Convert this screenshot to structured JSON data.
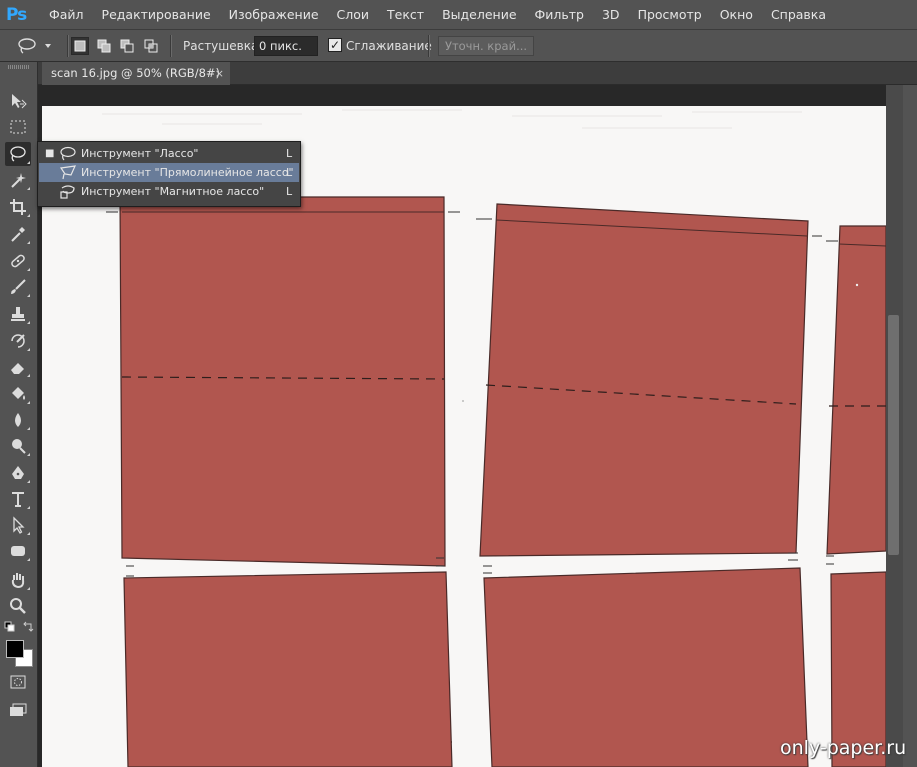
{
  "app": {
    "logo": "Ps",
    "brand_color": "#31a8ff"
  },
  "menu": [
    "Файл",
    "Редактирование",
    "Изображение",
    "Слои",
    "Текст",
    "Выделение",
    "Фильтр",
    "3D",
    "Просмотр",
    "Окно",
    "Справка"
  ],
  "options": {
    "tool_icon": "lasso-icon",
    "feather_label": "Растушевка:",
    "feather_value": "0 пикс.",
    "antialias_checked": true,
    "antialias_label": "Сглаживание",
    "refine_edge_label": "Уточн. край..."
  },
  "document": {
    "tab_title": "scan 16.jpg @ 50% (RGB/8#)",
    "close_glyph": "×"
  },
  "tools": [
    "move-icon",
    "marquee-icon",
    "lasso-icon",
    "magic-wand-icon",
    "crop-icon",
    "eyedropper-icon",
    "healing-brush-icon",
    "brush-icon",
    "clone-stamp-icon",
    "history-brush-icon",
    "eraser-icon",
    "paint-bucket-icon",
    "blur-icon",
    "dodge-icon",
    "pen-icon",
    "type-icon",
    "path-selection-icon",
    "shape-icon",
    "hand-icon",
    "zoom-icon",
    "quick-mask-icon",
    "screen-mode-icon"
  ],
  "flyout": {
    "items": [
      {
        "label": "Инструмент \"Лассо\"",
        "shortcut": "L",
        "selected": true,
        "highlighted": false
      },
      {
        "label": "Инструмент \"Прямолинейное лассо\"",
        "shortcut": "L",
        "selected": false,
        "highlighted": true
      },
      {
        "label": "Инструмент \"Магнитное лассо\"",
        "shortcut": "L",
        "selected": false,
        "highlighted": false
      }
    ]
  },
  "colors": {
    "foreground": "#000000",
    "background": "#ffffff",
    "paper_red": "#b1564f",
    "highlight": "#697c99"
  },
  "watermark": "only-paper.ru"
}
